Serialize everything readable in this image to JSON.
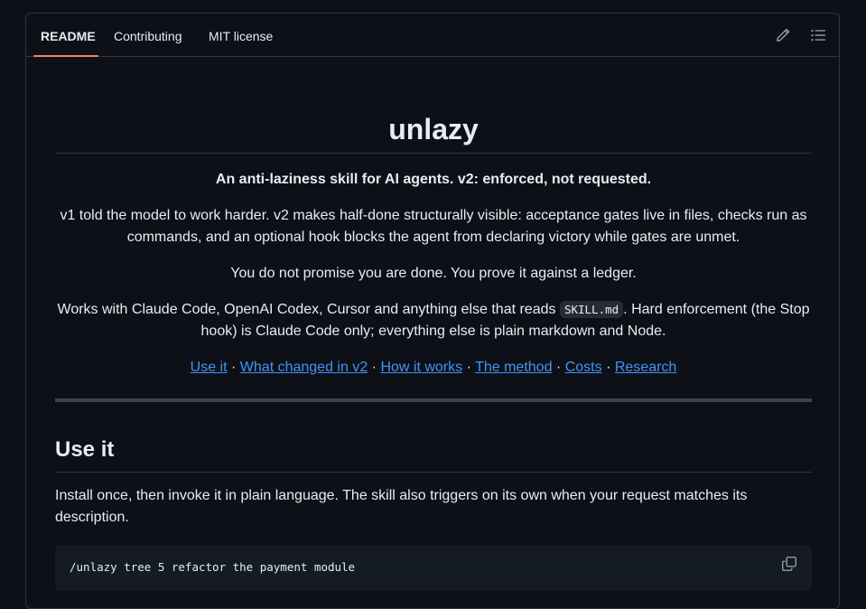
{
  "tabs": [
    {
      "label": "README",
      "active": true
    },
    {
      "label": "Contributing",
      "active": false
    },
    {
      "label": "MIT license",
      "active": false
    }
  ],
  "toolbar": {
    "edit_icon": "pencil-icon",
    "toc_icon": "list-icon"
  },
  "readme": {
    "title": "unlazy",
    "tagline": "An anti-laziness skill for AI agents. v2: enforced, not requested.",
    "p1": "v1 told the model to work harder. v2 makes half-done structurally visible: acceptance gates live in files, checks run as commands, and an optional hook blocks the agent from declaring victory while gates are unmet.",
    "p2": "You do not promise you are done. You prove it against a ledger.",
    "p3_before": "Works with Claude Code, OpenAI Codex, Cursor and anything else that reads ",
    "p3_code": "SKILL.md",
    "p3_after": ". Hard enforcement (the Stop hook) is Claude Code only; everything else is plain markdown and Node.",
    "links": [
      {
        "label": "Use it"
      },
      {
        "label": "What changed in v2"
      },
      {
        "label": "How it works"
      },
      {
        "label": "The method"
      },
      {
        "label": "Costs"
      },
      {
        "label": "Research"
      }
    ],
    "separator": "·",
    "section_heading": "Use it",
    "section_body": "Install once, then invoke it in plain language. The skill also triggers on its own when your request matches its description.",
    "code": "/unlazy tree 5 refactor the payment module",
    "copy_icon": "copy-icon"
  },
  "colors": {
    "background": "#0d1117",
    "border": "#30363d",
    "text": "#e6edf3",
    "link": "#4493f8",
    "active_tab_underline": "#f78166",
    "code_bg": "#151b23"
  }
}
